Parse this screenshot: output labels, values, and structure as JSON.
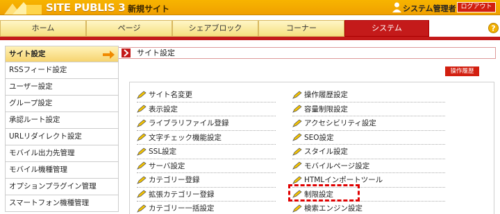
{
  "header": {
    "logo_text": "SITE PUBLIS 3",
    "site_name": "新規サイト",
    "user_name": "システム管理者",
    "logout_label": "ログアウト"
  },
  "nav": {
    "tabs": [
      "ホーム",
      "ページ",
      "シェアブロック",
      "コーナー",
      "システム"
    ],
    "active_index": 4
  },
  "sidebar": {
    "items": [
      {
        "label": "サイト設定"
      },
      {
        "label": "RSSフィード設定"
      },
      {
        "label": "ユーザー設定"
      },
      {
        "label": "グループ設定"
      },
      {
        "label": "承認ルート設定"
      },
      {
        "label": "URLリダイレクト設定"
      },
      {
        "label": "モバイル出力先管理"
      },
      {
        "label": "モバイル機種管理"
      },
      {
        "label": "オプションプラグイン管理"
      },
      {
        "label": "スマートフォン機種管理"
      }
    ]
  },
  "breadcrumb": {
    "label": "サイト設定"
  },
  "history_button": "操作履歴",
  "links_left": [
    "サイト名変更",
    "表示設定",
    "ライブラリファイル登録",
    "文字チェック機能設定",
    "SSL設定",
    "サーバ設定",
    "カテゴリー登録",
    "拡張カテゴリー登録",
    "カテゴリー一括設定"
  ],
  "links_right": [
    "操作履歴設定",
    "容量制限設定",
    "アクセシビリティ設定",
    "SEO設定",
    "スタイル設定",
    "モバイルページ設定",
    "HTMLインポートツール",
    "制限設定",
    "検索エンジン設定"
  ],
  "colors": {
    "brand_orange": "#f0a000",
    "accent_red": "#c41a1a",
    "highlight_dash": "#e00000"
  }
}
